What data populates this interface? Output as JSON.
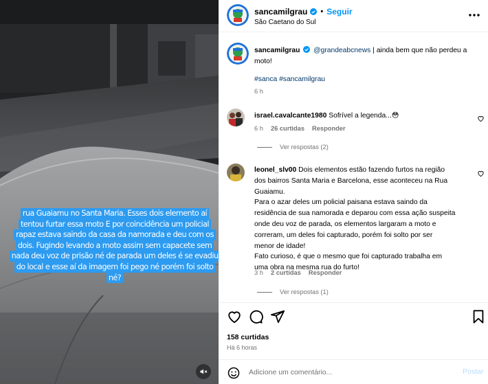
{
  "post": {
    "username": "sancamilgrau",
    "follow_label": "Seguir",
    "separator": "•",
    "location": "São Caetano do Sul",
    "video_caption_lines": [
      "rua Guaiamu no Santa Maria. Esses dois elemento aí",
      "tentou furtar essa moto E por coincidência um policial",
      "rapaz estava saindo da casa da namorada e deu com os",
      "dois. Fugindo levando a moto assim sem capacete sem",
      "nada deu voz de prisão né de parada um deles é se evadiu",
      "do local e esse aí da imagem foi pego né porém foi solto",
      "né?"
    ]
  },
  "caption": {
    "username": "sancamilgrau",
    "mention": "@grandeabcnews",
    "text": " | ainda bem que não perdeu a moto!",
    "hashtags": "#sanca #sancamilgrau",
    "time": "6 h"
  },
  "comments": [
    {
      "username": "israel.cavalcante1980",
      "text": "Sofrível a legenda...😳",
      "time": "6 h",
      "likes": "26 curtidas",
      "reply_label": "Responder",
      "view_replies": "Ver respostas (2)"
    },
    {
      "username": "leonel_slv00",
      "text_lines": [
        "Dois elementos estão fazendo furtos na região",
        "dos bairros Santa Maria e Barcelona, esse aconteceu na Rua",
        "Guaiamu.",
        "Para o azar deles um policial paisana estava saindo da",
        "residência de sua namorada e deparou com essa ação suspeita",
        "onde deu voz de parada, os elementos largaram a moto e",
        "correram, um deles foi capturado, porém foi solto por ser",
        "menor de idade!",
        "Fato curioso, é que o mesmo que foi capturado trabalha em",
        "uma obra na mesma rua do furto!"
      ],
      "time": "3 h",
      "likes": "2 curtidas",
      "reply_label": "Responder",
      "view_replies": "Ver respostas (1)"
    }
  ],
  "stats": {
    "likes": "158 curtidas",
    "time": "Há 6 horas"
  },
  "add_comment": {
    "placeholder": "Adicione um comentário...",
    "post_label": "Postar"
  },
  "colors": {
    "link": "#00376b",
    "accent": "#0095f6",
    "caption_bg": "#2d9bf0",
    "muted": "#737373"
  }
}
